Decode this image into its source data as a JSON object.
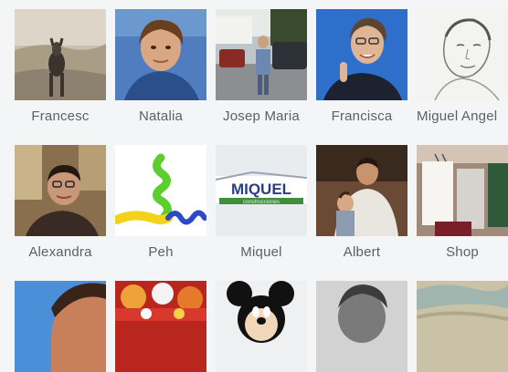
{
  "friends": [
    {
      "name": "Francesc"
    },
    {
      "name": "Natalia"
    },
    {
      "name": "Josep Maria"
    },
    {
      "name": "Francisca"
    },
    {
      "name": "Miguel Angel"
    },
    {
      "name": "Alexandra"
    },
    {
      "name": "Peh"
    },
    {
      "name": "Miquel"
    },
    {
      "name": "Albert"
    },
    {
      "name": "Shop"
    }
  ],
  "miquel_logo": {
    "brand": "MIQUEL",
    "sub": "construcciones"
  }
}
